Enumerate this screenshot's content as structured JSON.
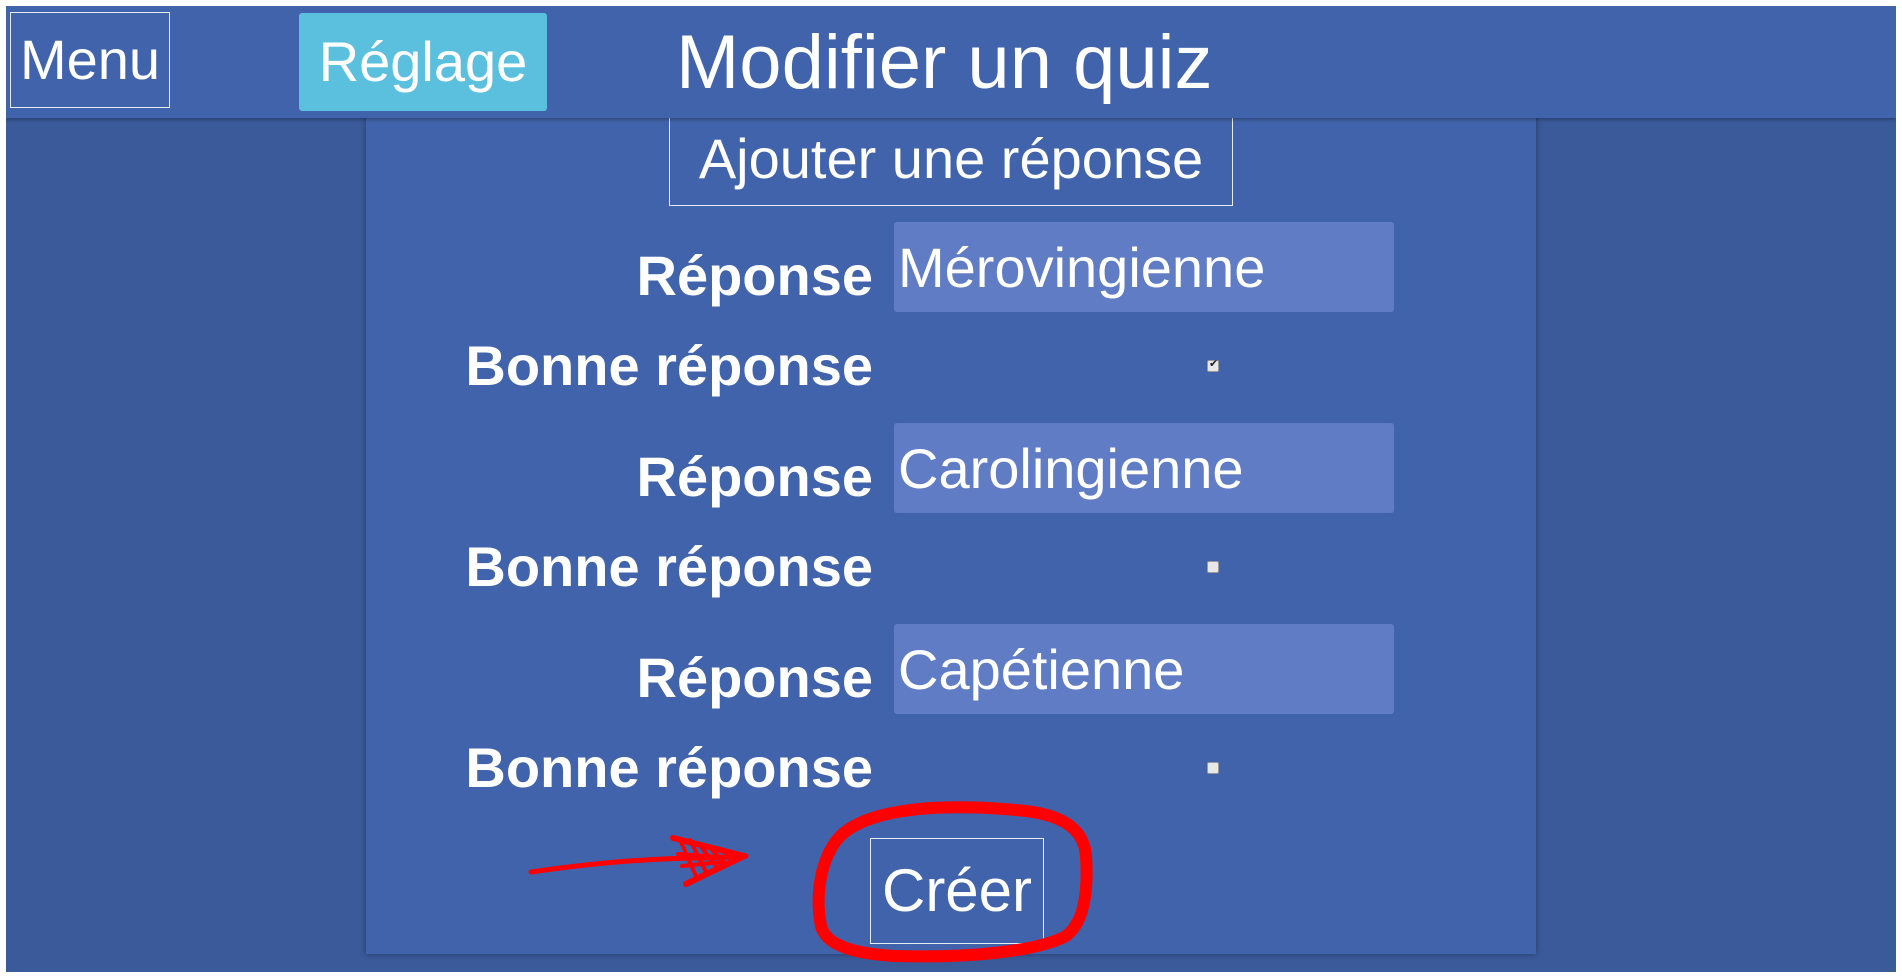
{
  "header": {
    "menu_label": "Menu",
    "settings_label": "Réglage",
    "title": "Modifier un quiz"
  },
  "form": {
    "add_answer_label": "Ajouter une réponse",
    "answer_label": "Réponse",
    "correct_label": "Bonne réponse",
    "answers": [
      {
        "value": "Mérovingienne",
        "correct": true
      },
      {
        "value": "Carolingienne",
        "correct": false
      },
      {
        "value": "Capétienne",
        "correct": false
      }
    ],
    "submit_label": "Créer"
  },
  "colors": {
    "background": "#3a5a9a",
    "panel": "#4163ab",
    "input": "#607cc4",
    "settings_button": "#5bc0de",
    "annotation": "#ff0000"
  }
}
